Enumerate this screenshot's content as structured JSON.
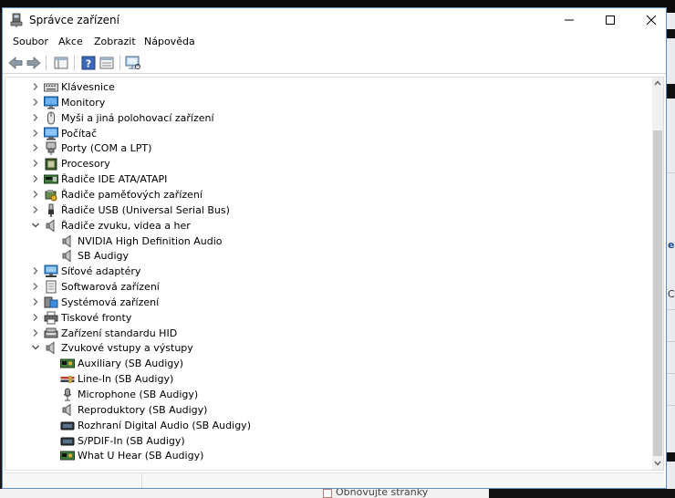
{
  "window": {
    "title": "Správce zařízení"
  },
  "menu": [
    "Soubor",
    "Akce",
    "Zobrazit",
    "Nápověda"
  ],
  "tree": [
    {
      "label": "Klávesnice",
      "icon": "keyboard-icon",
      "level": 0,
      "state": "collapsed"
    },
    {
      "label": "Monitory",
      "icon": "monitor-icon",
      "level": 0,
      "state": "collapsed"
    },
    {
      "label": "Myši a jiná polohovací zařízení",
      "icon": "mouse-icon",
      "level": 0,
      "state": "collapsed"
    },
    {
      "label": "Počítač",
      "icon": "computer-icon",
      "level": 0,
      "state": "collapsed"
    },
    {
      "label": "Porty (COM a LPT)",
      "icon": "port-icon",
      "level": 0,
      "state": "collapsed"
    },
    {
      "label": "Procesory",
      "icon": "processor-icon",
      "level": 0,
      "state": "collapsed"
    },
    {
      "label": "Řadiče IDE ATA/ATAPI",
      "icon": "ide-controller-icon",
      "level": 0,
      "state": "collapsed"
    },
    {
      "label": "Řadiče paměťových zařízení",
      "icon": "storage-controller-icon",
      "level": 0,
      "state": "collapsed"
    },
    {
      "label": "Řadiče USB (Universal Serial Bus)",
      "icon": "usb-icon",
      "level": 0,
      "state": "collapsed"
    },
    {
      "label": "Řadiče zvuku, videa a her",
      "icon": "speaker-icon",
      "level": 0,
      "state": "expanded"
    },
    {
      "label": "NVIDIA High Definition Audio",
      "icon": "speaker-icon",
      "level": 1,
      "state": "leaf"
    },
    {
      "label": "SB Audigy",
      "icon": "speaker-icon",
      "level": 1,
      "state": "leaf"
    },
    {
      "label": "Síťové adaptéry",
      "icon": "network-adapter-icon",
      "level": 0,
      "state": "collapsed"
    },
    {
      "label": "Softwarová zařízení",
      "icon": "software-device-icon",
      "level": 0,
      "state": "collapsed"
    },
    {
      "label": "Systémová zařízení",
      "icon": "system-device-icon",
      "level": 0,
      "state": "collapsed"
    },
    {
      "label": "Tiskové fronty",
      "icon": "printer-icon",
      "level": 0,
      "state": "collapsed"
    },
    {
      "label": "Zařízení standardu HID",
      "icon": "hid-icon",
      "level": 0,
      "state": "collapsed"
    },
    {
      "label": "Zvukové vstupy a výstupy",
      "icon": "speaker-icon",
      "level": 0,
      "state": "expanded"
    },
    {
      "label": "Auxiliary (SB Audigy)",
      "icon": "audio-card-icon",
      "level": 1,
      "state": "leaf"
    },
    {
      "label": "Line-In (SB Audigy)",
      "icon": "line-in-icon",
      "level": 1,
      "state": "leaf"
    },
    {
      "label": "Microphone (SB Audigy)",
      "icon": "microphone-icon",
      "level": 1,
      "state": "leaf"
    },
    {
      "label": "Reproduktory (SB Audigy)",
      "icon": "speaker-icon",
      "level": 1,
      "state": "leaf"
    },
    {
      "label": "Rozhraní Digital Audio (SB Audigy)",
      "icon": "digital-audio-icon",
      "level": 1,
      "state": "leaf"
    },
    {
      "label": "S/PDIF-In (SB Audigy)",
      "icon": "digital-audio-icon",
      "level": 1,
      "state": "leaf"
    },
    {
      "label": "What U Hear (SB Audigy)",
      "icon": "audio-card-icon",
      "level": 1,
      "state": "leaf"
    }
  ],
  "background": {
    "snippet": "Obnovujte stránky"
  },
  "colors": {
    "accent": "#3c7fd1",
    "selection": "#cce8ff"
  }
}
